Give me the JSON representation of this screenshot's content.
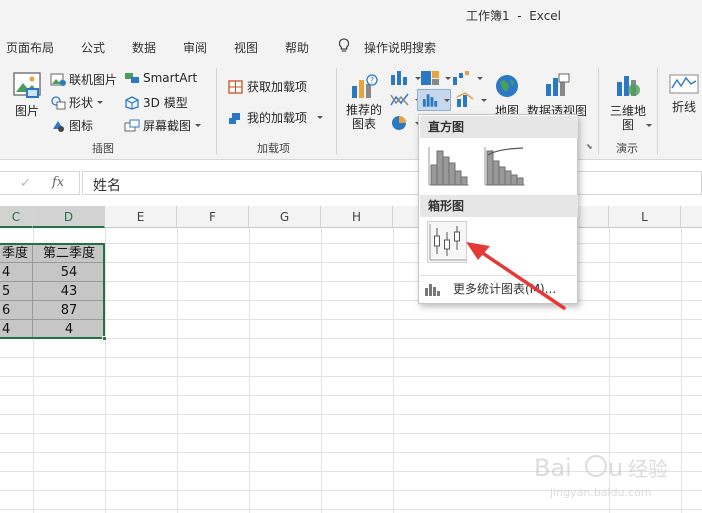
{
  "window": {
    "title": "工作簿1  -  Excel"
  },
  "tabs": [
    "页面布局",
    "公式",
    "数据",
    "审阅",
    "视图",
    "帮助",
    "操作说明搜索"
  ],
  "ribbon": {
    "illustrations": {
      "picture": "图片",
      "online_picture": "联机图片",
      "shapes": "形状",
      "icons": "图标",
      "smartart": "SmartArt",
      "model_3d": "3D 模型",
      "screenshot": "屏幕截图",
      "group_label": "插图"
    },
    "addins": {
      "get_addins": "获取加载项",
      "my_addins": "我的加载项",
      "group_label": "加载项"
    },
    "charts": {
      "recommended": "推荐的\n图表",
      "maps": "地图",
      "pivot_chart": "数据透视图",
      "group_label": "图表"
    },
    "tours": {
      "map_3d": "三维地\n图",
      "group_label": "演示"
    },
    "sparklines": {
      "line": "折线"
    }
  },
  "formula_bar": {
    "content": "姓名"
  },
  "grid": {
    "columns": [
      "C",
      "D",
      "E",
      "F",
      "G",
      "H",
      "L"
    ],
    "col_c_values": [
      "季度",
      "4",
      "5",
      "6",
      "4"
    ],
    "col_d_values": [
      "第二季度",
      "54",
      "43",
      "87",
      "4"
    ]
  },
  "dropdown": {
    "section1": "直方图",
    "section2": "箱形图",
    "more": "更多统计图表(M)..."
  },
  "colors": {
    "accent": "#217346",
    "arrow": "#e53935"
  }
}
